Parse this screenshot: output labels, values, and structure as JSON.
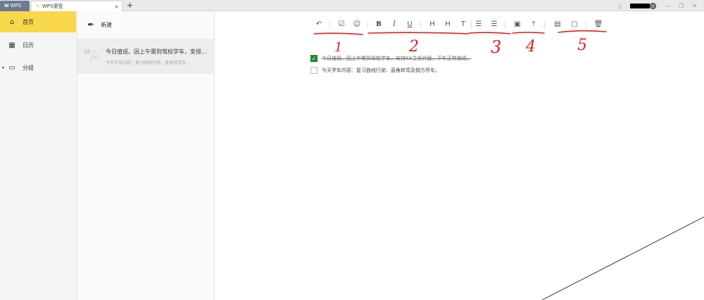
{
  "titlebar": {
    "tabs": [
      {
        "label": "WPS"
      },
      {
        "label": "WPS便签"
      }
    ],
    "new_tab": "+",
    "close": "×"
  },
  "sidebar": {
    "items": [
      {
        "label": "首页",
        "icon": "home-icon",
        "active": true
      },
      {
        "label": "日历",
        "icon": "calendar-icon"
      },
      {
        "label": "分组",
        "icon": "folder-icon"
      }
    ]
  },
  "notelist": {
    "new_label": "新建",
    "notes": [
      {
        "month": "08",
        "day": "07",
        "title": "今日值班。因上午需到驾校学车，安排...",
        "preview": "今天学车内容：复习曲线行驶、直角转弯及..."
      }
    ]
  },
  "toolbar": {
    "buttons": [
      {
        "name": "undo",
        "glyph": "↶"
      },
      {
        "name": "checkbox",
        "glyph": "☑"
      },
      {
        "name": "emoji",
        "glyph": "☺"
      },
      {
        "name": "bold",
        "glyph": "B"
      },
      {
        "name": "italic",
        "glyph": "I"
      },
      {
        "name": "underline",
        "glyph": "U"
      },
      {
        "name": "heading1",
        "glyph": "H"
      },
      {
        "name": "heading2",
        "glyph": "H"
      },
      {
        "name": "text",
        "glyph": "T"
      },
      {
        "name": "ordered-list",
        "glyph": "☰"
      },
      {
        "name": "bullet-list",
        "glyph": "☰"
      },
      {
        "name": "remind",
        "glyph": "▣"
      },
      {
        "name": "pin-top",
        "glyph": "⤒"
      },
      {
        "name": "move-group",
        "glyph": "▤"
      },
      {
        "name": "folder-settings",
        "glyph": "▢"
      },
      {
        "name": "delete",
        "glyph": "🗑"
      }
    ]
  },
  "content": {
    "tasks": [
      {
        "text": "今日值班。因上午需到驾校学车，安排XX主任代替，下午正常值班。",
        "done": true
      },
      {
        "text": "今天学车内容：复习曲线行驶、直角转弯及倒方停车。",
        "done": false
      }
    ]
  },
  "annotations": {
    "labels": [
      "1",
      "2",
      "3",
      "4",
      "5"
    ],
    "color": "#e0201b"
  }
}
